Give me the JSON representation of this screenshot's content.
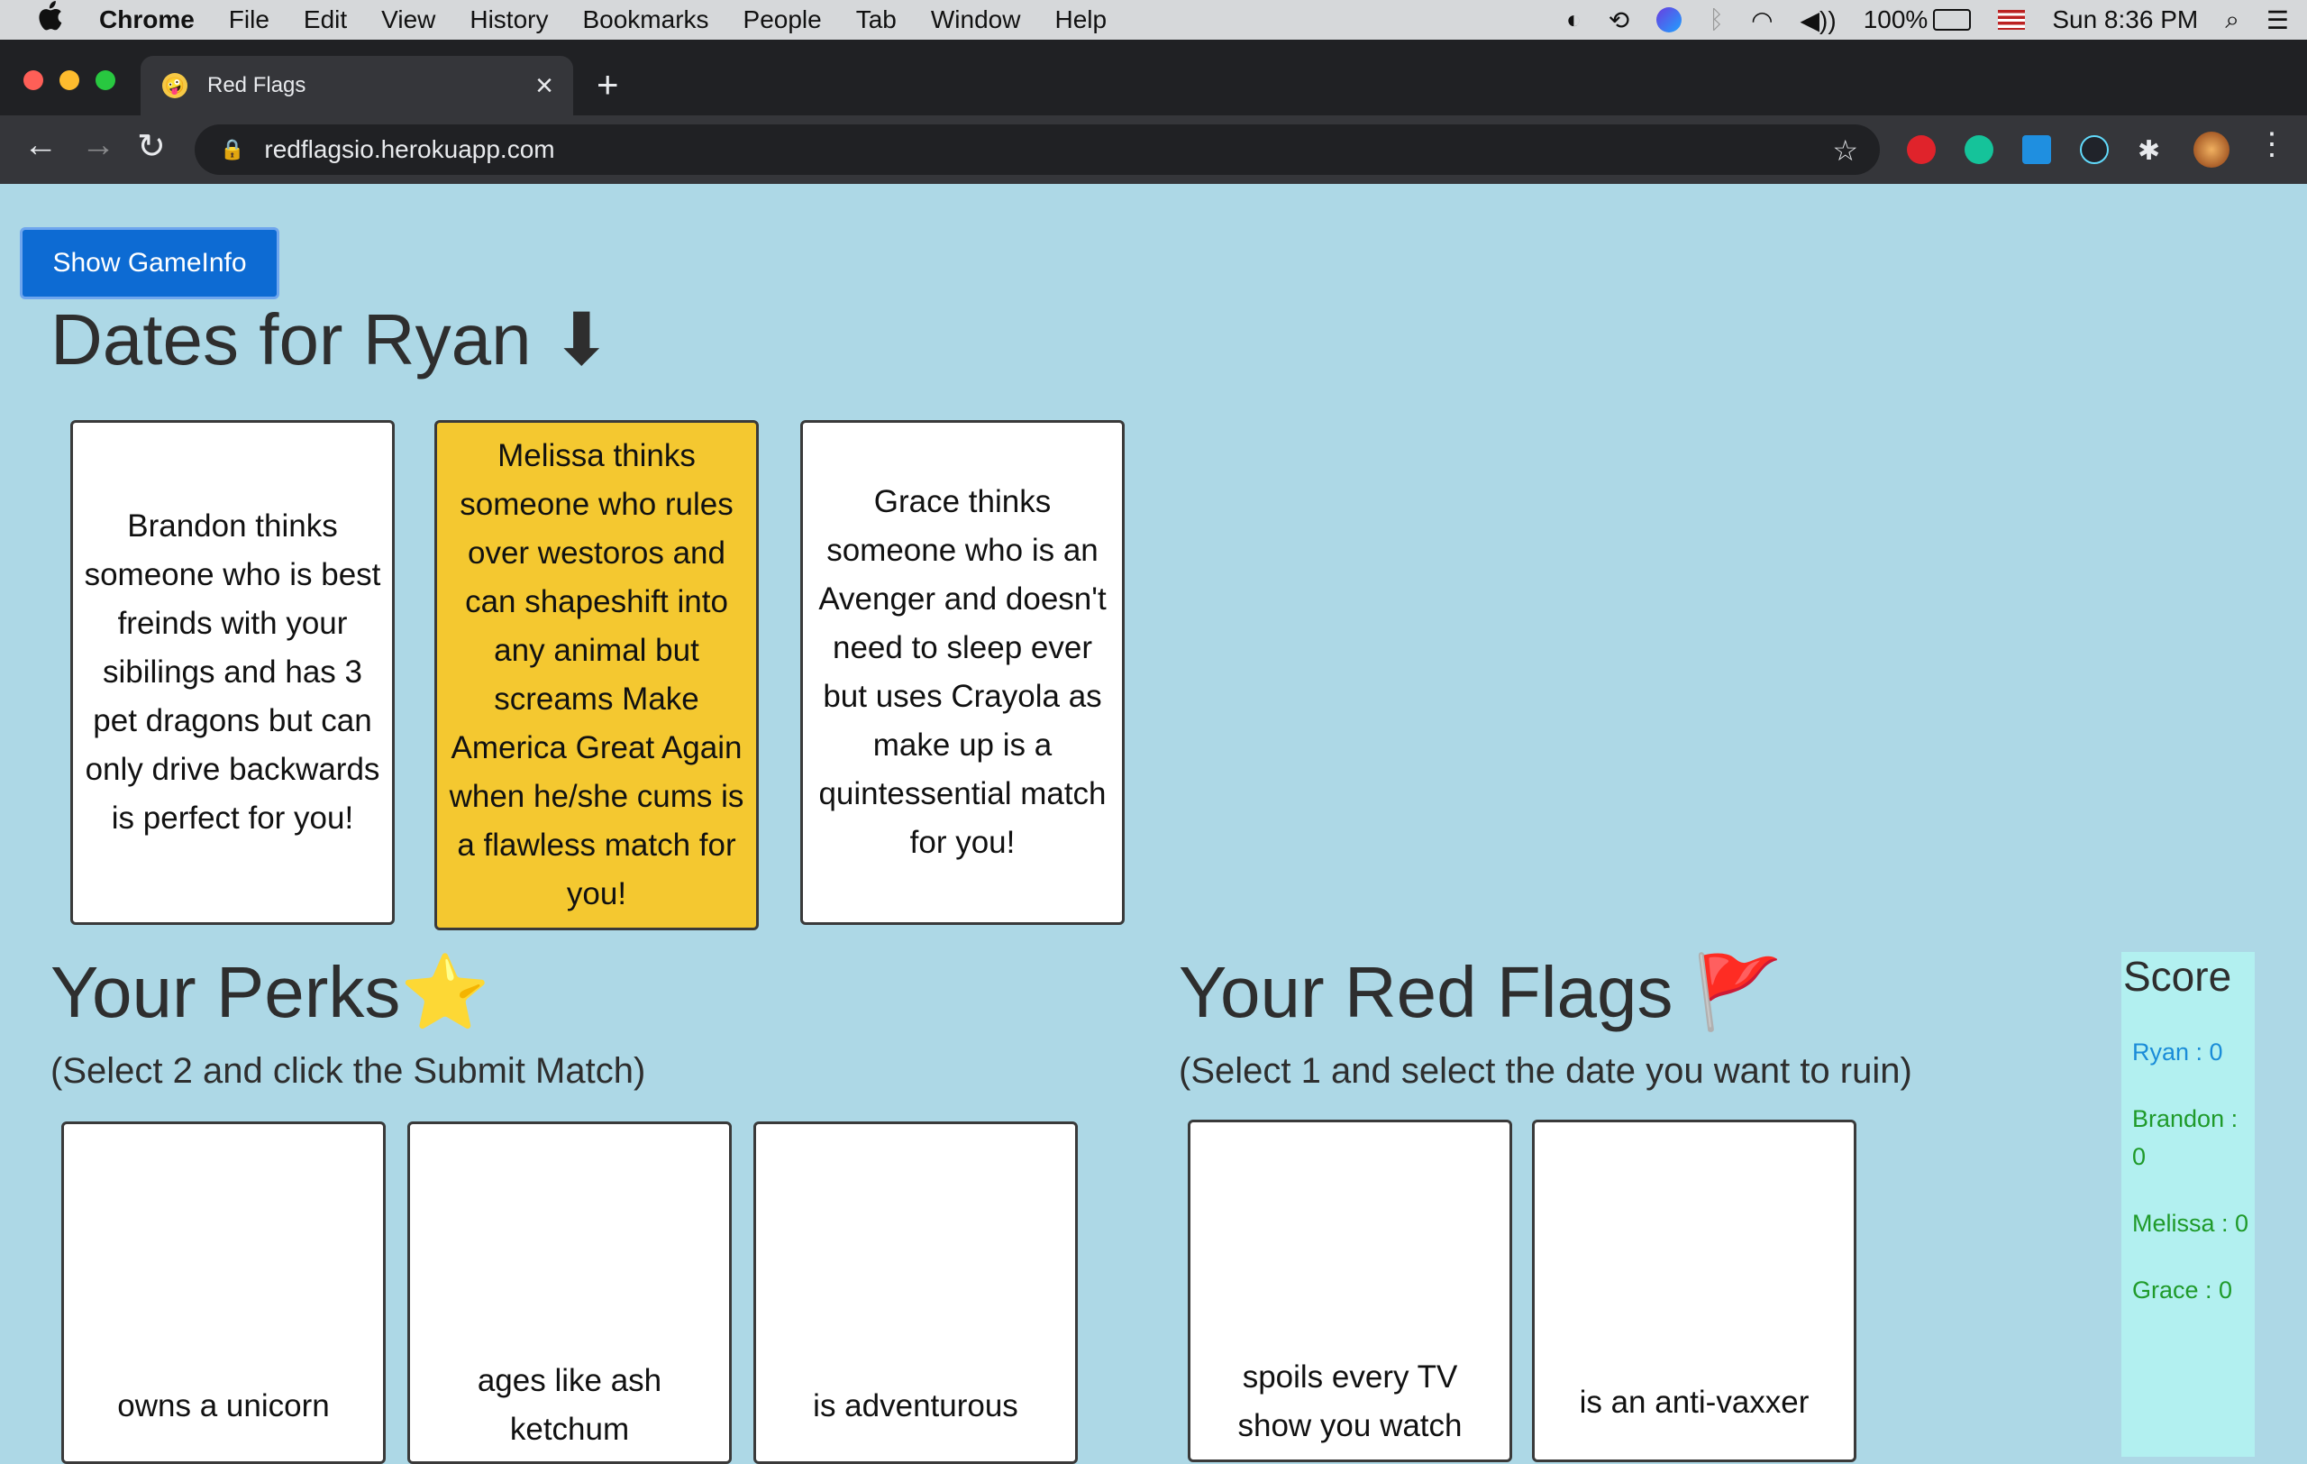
{
  "menubar": {
    "app": "Chrome",
    "items": [
      "File",
      "Edit",
      "View",
      "History",
      "Bookmarks",
      "People",
      "Tab",
      "Window",
      "Help"
    ],
    "battery": "100%",
    "clock": "Sun 8:36 PM"
  },
  "browser": {
    "tab_title": "Red Flags",
    "url": "redflagsio.herokuapp.com"
  },
  "page": {
    "gameinfo_button": "Show GameInfo",
    "dates_heading": "Dates for Ryan ⬇",
    "dates": [
      {
        "text": "Brandon thinks someone who is best freinds with your sibilings and has 3 pet dragons but can only drive backwards is perfect for you!",
        "selected": false
      },
      {
        "text": "Melissa thinks someone who rules over westoros and can shapeshift into any animal but screams Make America Great Again when he/she cums is a flawless match for you!",
        "selected": true
      },
      {
        "text": "Grace thinks someone who is an Avenger and doesn't need to sleep ever but uses Crayola as make up is a quintessential match for you!",
        "selected": false
      }
    ],
    "perks_heading": "Your Perks⭐",
    "perks_sub": "(Select 2 and click the Submit Match)",
    "perks": [
      "owns a unicorn",
      "ages like ash ketchum",
      "is adventurous"
    ],
    "flags_heading": "Your Red Flags 🚩",
    "flags_sub": "(Select 1 and select the date you want to ruin)",
    "flags": [
      "spoils every TV show you watch",
      "is an anti-vaxxer"
    ],
    "score_title": "Score",
    "scores": [
      {
        "text": "Ryan : 0",
        "color": "#1a8cd8"
      },
      {
        "text": "Brandon : 0",
        "color": "#1f9a2a"
      },
      {
        "text": "Melissa : 0",
        "color": "#1f9a2a"
      },
      {
        "text": "Grace : 0",
        "color": "#1f9a2a"
      }
    ]
  }
}
